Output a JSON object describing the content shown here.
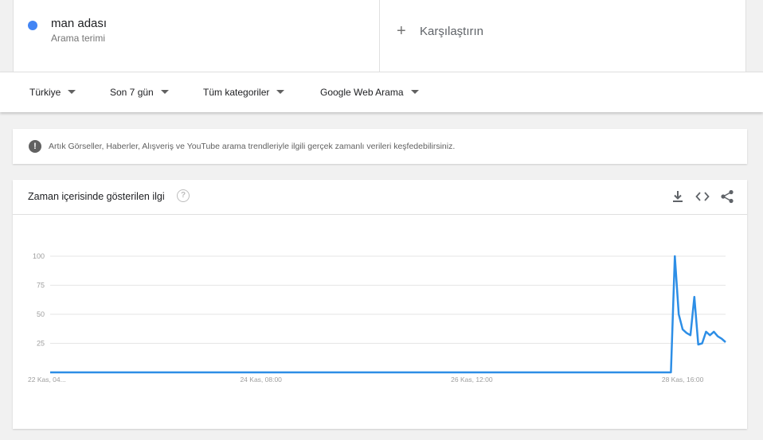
{
  "search_term": {
    "name": "man adası",
    "subtitle": "Arama terimi",
    "color": "#4285f4"
  },
  "compare": {
    "label": "Karşılaştırın"
  },
  "filters": {
    "region": "Türkiye",
    "time": "Son 7 gün",
    "category": "Tüm kategoriler",
    "search_type": "Google Web Arama"
  },
  "banner": {
    "text": "Artık Görseller, Haberler, Alışveriş ve YouTube arama trendleriyle ilgili gerçek zamanlı verileri keşfedebilirsiniz."
  },
  "chart_card": {
    "title": "Zaman içerisinde gösterilen ilgi",
    "help_symbol": "?"
  },
  "icons": {
    "download": "download-icon",
    "embed": "embed-code-icon",
    "share": "share-icon",
    "help": "help-icon",
    "info": "info-icon"
  },
  "chart_data": {
    "type": "line",
    "title": "Zaman içerisinde gösterilen ilgi",
    "xlabel": "",
    "ylabel": "",
    "ylim": [
      0,
      100
    ],
    "yticks": [
      25,
      50,
      75,
      100
    ],
    "xtick_labels": [
      "22 Kas, 04...",
      "24 Kas, 08:00",
      "26 Kas, 12:00",
      "28 Kas, 16:00"
    ],
    "xtick_positions": [
      0,
      54,
      108,
      162
    ],
    "x_count": 173,
    "grid": true,
    "line_color": "#2d8ee6",
    "series": [
      {
        "points": [
          [
            0,
            0
          ],
          [
            158,
            0
          ],
          [
            159,
            0
          ],
          [
            160,
            100
          ],
          [
            161,
            50
          ],
          [
            162,
            37
          ],
          [
            163,
            34
          ],
          [
            164,
            32
          ],
          [
            165,
            65
          ],
          [
            166,
            24
          ],
          [
            167,
            25
          ],
          [
            168,
            35
          ],
          [
            169,
            32
          ],
          [
            170,
            35
          ],
          [
            171,
            31
          ],
          [
            172,
            29
          ],
          [
            173,
            26
          ]
        ]
      }
    ]
  }
}
